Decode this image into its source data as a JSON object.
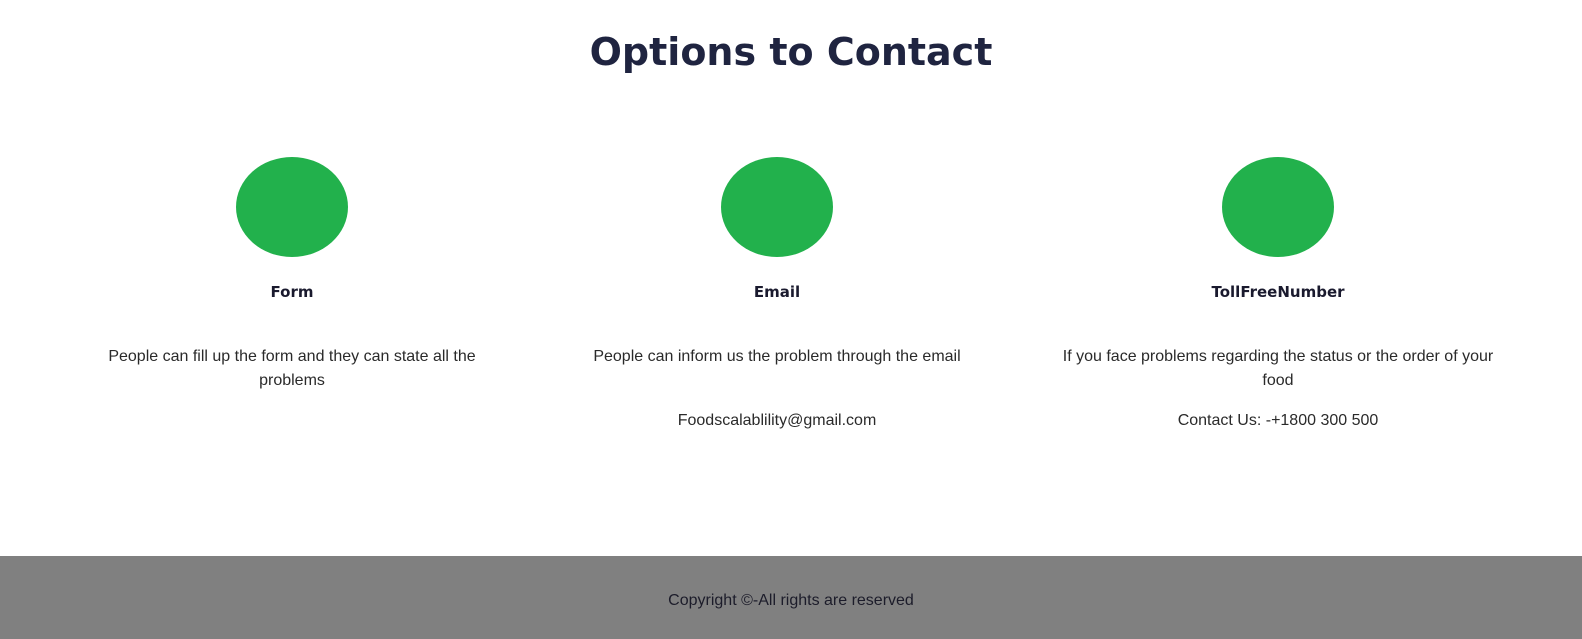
{
  "page": {
    "title": "Options to Contact"
  },
  "options": [
    {
      "icon": "green-circle-icon",
      "title": "Form",
      "description": "People can fill up the form and they can state all the problems"
    },
    {
      "icon": "green-circle-icon",
      "title": "Email",
      "description": "People can inform us the problem through the email",
      "extra": "Foodscalablility@gmail.com"
    },
    {
      "icon": "green-circle-icon",
      "title": "TollFreeNumber",
      "description": "If you face problems regarding the status or the order of your food",
      "extra": "Contact Us: -+1800 300 500"
    }
  ],
  "footer": {
    "copyright": "Copyright ©-All rights are reserved"
  },
  "colors": {
    "accent": "#22b14c",
    "footer_bg": "#808080",
    "heading": "#1f2440"
  }
}
